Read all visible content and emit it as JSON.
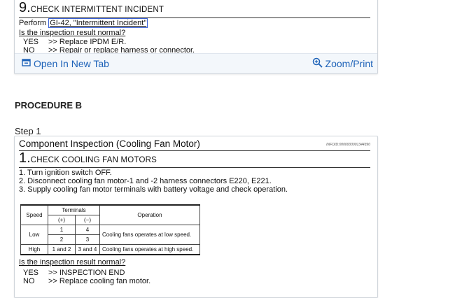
{
  "prev_card": {
    "step_number": "9.",
    "step_title": "CHECK INTERMITTENT INCIDENT",
    "perform_prefix": "Perform",
    "perform_link": "GI-42, \"Intermittent Incident\"",
    "question": "Is the inspection result normal?",
    "answers": [
      {
        "key": "YES",
        "value": ">> Replace IPDM E/R."
      },
      {
        "key": "NO",
        "value": ">> Repair or replace harness or connector."
      }
    ]
  },
  "toolbar": {
    "open_label": "Open In New Tab",
    "zoom_label": "Zoom/Print",
    "open_icon": "open-in-new-tab-icon",
    "zoom_icon": "zoom-magnifier-icon",
    "accent": "#1d62b8"
  },
  "procedure_heading": "PROCEDURE B",
  "step_label": "Step 1",
  "card": {
    "title": "Component Inspection (Cooling Fan Motor)",
    "info_id": "INFOID:0000000001344390",
    "step_number": "1.",
    "step_title": "CHECK COOLING FAN MOTORS",
    "instructions": [
      "1.   Turn ignition switch OFF.",
      "2.   Disconnect cooling fan motor-1 and -2 harness connectors E220, E221.",
      "3.   Supply cooling fan motor terminals with battery voltage and check operation."
    ],
    "table": {
      "speed_header": "Speed",
      "terminals_header": "Terminals",
      "plus_header": "(+)",
      "minus_header": "(−)",
      "operation_header": "Operation",
      "low": "Low",
      "low_rows": [
        [
          "1",
          "4"
        ],
        [
          "2",
          "3"
        ]
      ],
      "low_op": "Cooling fans operates at low speed.",
      "high": "High",
      "high_plus": "1 and 2",
      "high_minus": "3 and 4",
      "high_op": "Cooling fans operates at high speed."
    },
    "question": "Is the inspection result normal?",
    "answers": [
      {
        "key": "YES",
        "value": ">> INSPECTION END"
      },
      {
        "key": "NO",
        "value": ">> Replace cooling fan motor."
      }
    ]
  }
}
